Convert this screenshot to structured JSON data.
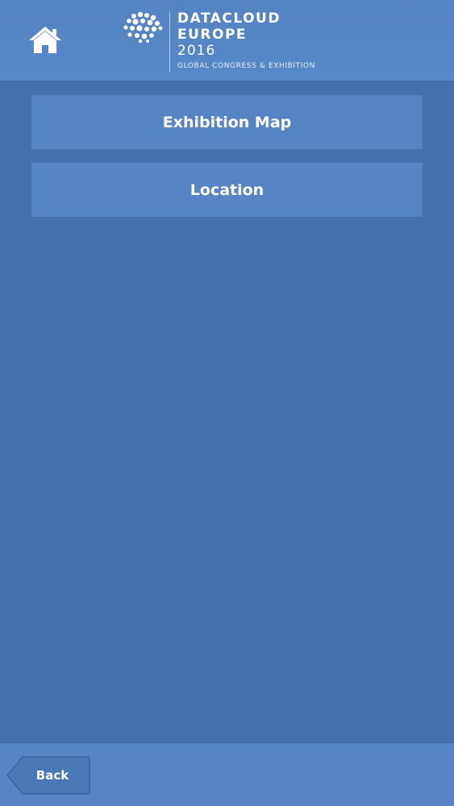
{
  "header": {
    "home_icon": "home-icon",
    "logo": {
      "line1": "DATACLOUD",
      "line2": "EUROPE",
      "line3": "2016",
      "tagline": "GLOBAL CONGRESS & EXHIBITION"
    }
  },
  "menu": {
    "items": [
      {
        "label": "Exhibition Map"
      },
      {
        "label": "Location"
      }
    ]
  },
  "footer": {
    "back_label": "Back"
  },
  "colors": {
    "background": "#4470ad",
    "header": "#5583c3",
    "button": "#5684c4",
    "text": "#ffffff"
  }
}
